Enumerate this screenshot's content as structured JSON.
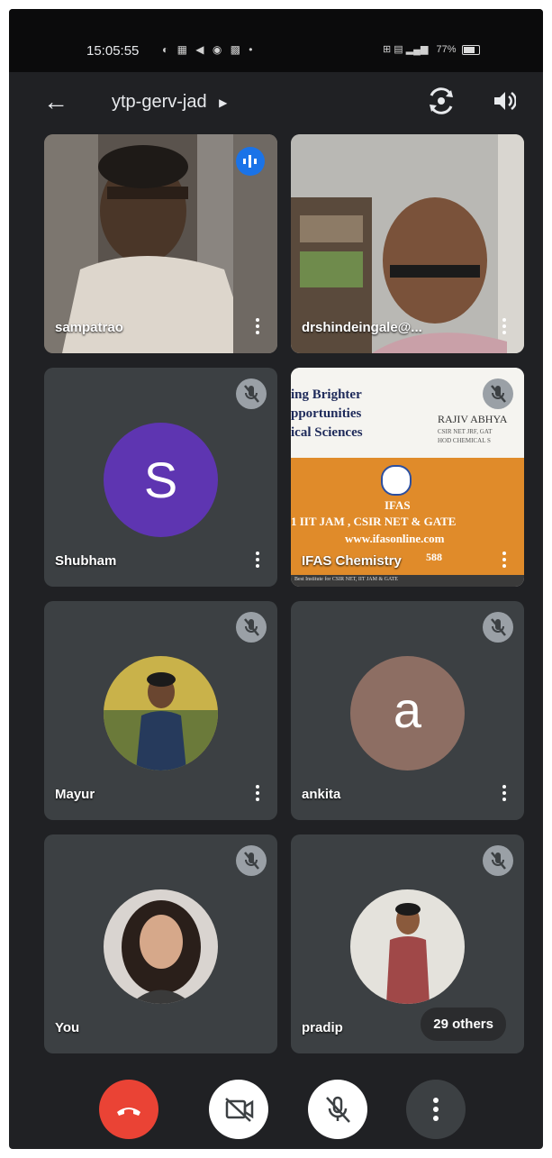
{
  "status_bar": {
    "time": "15:05:55",
    "battery": "77%"
  },
  "header": {
    "meeting_code": "ytp-gerv-jad"
  },
  "participants": [
    {
      "name": "sampatrao",
      "speaking": true
    },
    {
      "name": "drshindeingale@..."
    },
    {
      "name": "Shubham",
      "initial": "S",
      "avatar_color": "#5e35b1",
      "muted": true
    },
    {
      "name": "IFAS Chemistry",
      "muted": true,
      "slide": {
        "line1": "ing Brighter",
        "line2": "pportunities",
        "line3": "ical Sciences",
        "teacher": "RAJIV ABHYA",
        "teacher_sub1": "CSIR NET JRF, GAT",
        "teacher_sub2": "HOD CHEMICAL S",
        "brand": "IFAS",
        "tagline": "1 IIT JAM , CSIR NET & GATE",
        "url": "www.ifasonline.com",
        "partial_number": "588",
        "footer": "Best Institute for CSIR NET, IIT JAM & GATE"
      }
    },
    {
      "name": "Mayur",
      "muted": true
    },
    {
      "name": "ankita",
      "initial": "a",
      "avatar_color": "#8d6e63",
      "muted": true
    },
    {
      "name": "You",
      "muted": true
    },
    {
      "name": "pradip",
      "muted": true
    }
  ],
  "others_chip": "29 others",
  "controls": {
    "hangup_color": "#ea4335"
  }
}
